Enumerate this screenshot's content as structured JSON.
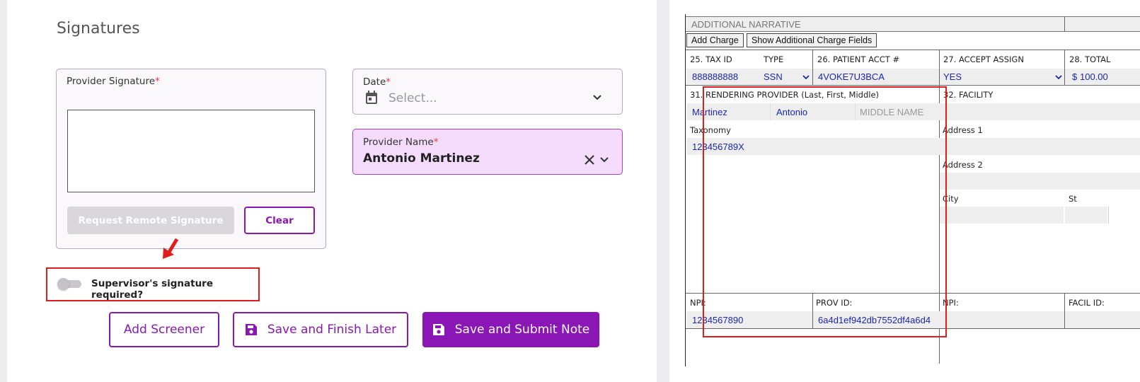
{
  "signatures": {
    "title": "Signatures",
    "provider_signature": {
      "label": "Provider Signature",
      "required_mark": "*"
    },
    "request_remote_label": "Request Remote Signature",
    "clear_label": "Clear",
    "date": {
      "label": "Date",
      "required_mark": "*",
      "placeholder": "Select..."
    },
    "provider_name": {
      "label": "Provider Name",
      "required_mark": "*",
      "value": "Antonio Martinez"
    },
    "supervisor_toggle": {
      "label": "Supervisor's signature required?",
      "checked": false
    }
  },
  "actions": {
    "add_screener": "Add Screener",
    "save_finish_later": "Save and Finish Later",
    "save_submit": "Save and Submit Note"
  },
  "claim_form": {
    "additional_narrative": "ADDITIONAL NARRATIVE",
    "add_charge": "Add Charge",
    "show_additional_fields": "Show Additional Charge Fields",
    "tax_id": {
      "label": "25. TAX ID",
      "value": "888888888"
    },
    "type": {
      "label": "TYPE",
      "value": "SSN"
    },
    "patient_acct": {
      "label": "26. PATIENT ACCT #",
      "value": "4VOKE7U3BCA"
    },
    "accept_assign": {
      "label": "27. ACCEPT ASSIGN",
      "value": "YES"
    },
    "total": {
      "label": "28. TOTAL",
      "currency": "$",
      "value": "100.00"
    },
    "rendering_provider": {
      "label": "31. RENDERING PROVIDER (Last, First, Middle)",
      "last": "Martinez",
      "first": "Antonio",
      "middle_placeholder": "MIDDLE NAME",
      "taxonomy_label": "Taxonomy",
      "taxonomy": "123456789X",
      "npi_label": "NPI:",
      "npi": "1234567890",
      "prov_id_label": "PROV ID:",
      "prov_id": "6a4d1ef942db7552df4a6d4"
    },
    "facility": {
      "label": "32. FACILITY",
      "address1_label": "Address 1",
      "address2_label": "Address 2",
      "city_label": "City",
      "state_label": "St",
      "npi_label": "NPI:",
      "facil_id_label": "FACIL ID:"
    }
  },
  "colors": {
    "brand_purple": "#8a16b5",
    "highlight_red": "#e01d1d",
    "form_value_blue": "#1b26b0"
  }
}
